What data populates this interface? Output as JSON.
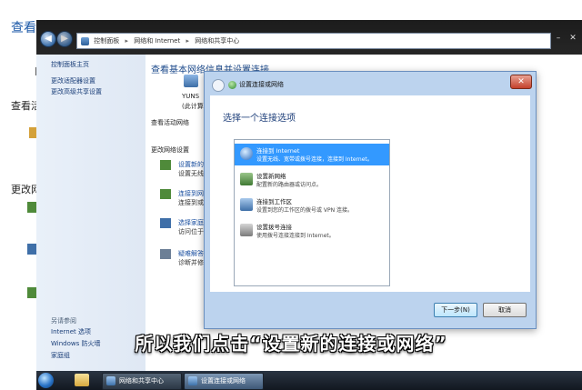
{
  "background": {
    "heading": "查看",
    "p_char": "P",
    "sub1": "查看活",
    "sub2": "更改网"
  },
  "explorer": {
    "breadcrumb": [
      "控制面板",
      "网络和 Internet",
      "网络和共享中心"
    ],
    "sidebar": {
      "links": [
        "控制面板主页",
        "更改适配器设置",
        "更改高级共享设置"
      ],
      "see_also_label": "另请参阅",
      "see_also": [
        "Internet 选项",
        "Windows 防火墙",
        "家庭组"
      ]
    },
    "content": {
      "title": "查看基本网络信息并设置连接",
      "pc_name": "YUNS",
      "pc_sub": "(此计算",
      "active_networks": "查看活动网络",
      "change_settings": "更改网络设置",
      "tasks": [
        {
          "link": "设置新的",
          "desc": "设置无线"
        },
        {
          "link": "连接到网",
          "desc": "连接到或"
        },
        {
          "link": "选择家庭",
          "desc": "访问位于"
        },
        {
          "link": "疑难解答",
          "desc": "诊断并修"
        }
      ]
    }
  },
  "dialog": {
    "title": "设置连接或网络",
    "heading": "选择一个连接选项",
    "options": [
      {
        "title": "连接到 Internet",
        "desc": "设置无线、宽带或拨号连接，连接到 Internet。",
        "icon": "globe-icon"
      },
      {
        "title": "设置新网络",
        "desc": "配置新的路由器或访问点。",
        "icon": "router-icon"
      },
      {
        "title": "连接到工作区",
        "desc": "设置到您的工作区的拨号或 VPN 连接。",
        "icon": "workplace-icon"
      },
      {
        "title": "设置拨号连接",
        "desc": "使用拨号连接连接到 Internet。",
        "icon": "modem-icon"
      }
    ],
    "next_label": "下一步(N)",
    "cancel_label": "取消"
  },
  "subtitle": "所以我们点击“设置新的连接或网络”",
  "taskbar": {
    "items": [
      "网络和共享中心",
      "设置连接或网络"
    ]
  },
  "colors": {
    "accent": "#3399ff",
    "link": "#1a4fa0",
    "dialog_frame": "#bcd3ee"
  }
}
